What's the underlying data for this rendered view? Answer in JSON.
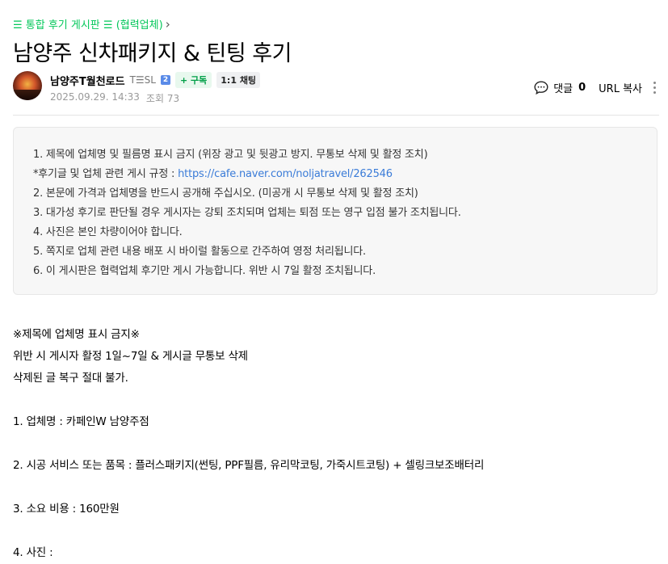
{
  "board": {
    "label": "☰ 통합 후기 게시판 ☰ (협력업체)",
    "chevron": "›"
  },
  "post": {
    "title": "남양주 신차패키지 & 틴팅 후기"
  },
  "author": {
    "name": "남양주T월천로드",
    "grade": "T☰SL",
    "grade_badge": "2",
    "subscribe_label": "+ 구독",
    "chat_label": "1:1 채팅"
  },
  "meta": {
    "date": "2025.09.29. 14:33",
    "views": "조회 73"
  },
  "tools": {
    "comment_label": "댓글",
    "comment_count": "0",
    "url_copy_label": "URL 복사"
  },
  "notice": {
    "lines": [
      "1. 제목에 업체명 및 필름명 표시 금지 (위장 광고 및 뒷광고 방지. 무통보 삭제 및 활정 조치)",
      "*후기글 및 업체 관련 게시 규정 : ",
      "2. 본문에 가격과 업체명을 반드시 공개해 주십시오. (미공개 시 무통보 삭제 및 활정 조치)",
      "3. 대가성 후기로 판단될 경우 게시자는 강퇴 조치되며 업체는 퇴점 또는 영구 입점 불가 조치됩니다.",
      "4. 사진은 본인 차량이어야 합니다.",
      "5. 쪽지로 업체 관련 내용 배포 시 바이럴 활동으로 간주하여 영정 처리됩니다.",
      "6. 이 게시판은 협력업체 후기만 게시 가능합니다. 위반 시 7일 활정 조치됩니다."
    ],
    "link": "https://cafe.naver.com/noljatravel/262546"
  },
  "body": {
    "warning_title": "※제목에 업체명 표시 금지※",
    "warning_line1": "위반 시 게시자 활정 1일~7일 & 게시글 무통보 삭제",
    "warning_line2": "삭제된 글 복구 절대 불가.",
    "item1": "1. 업체명 :  카페인W 남양주점",
    "item2": "2. 시공 서비스 또는 품목 :  플러스패키지(썬팅, PPF필름, 유리막코팅, 가죽시트코팅) + 셀링크보조배터리",
    "item3": "3. 소요 비용 :  160만원",
    "item4": "4. 사진 :"
  },
  "colors": {
    "brand_green": "#03c75a",
    "link_blue": "#3b7cd8"
  },
  "icons": {
    "comment": "speech-bubble-icon",
    "more": "vertical-dots-icon",
    "chevron": "chevron-right-icon"
  }
}
